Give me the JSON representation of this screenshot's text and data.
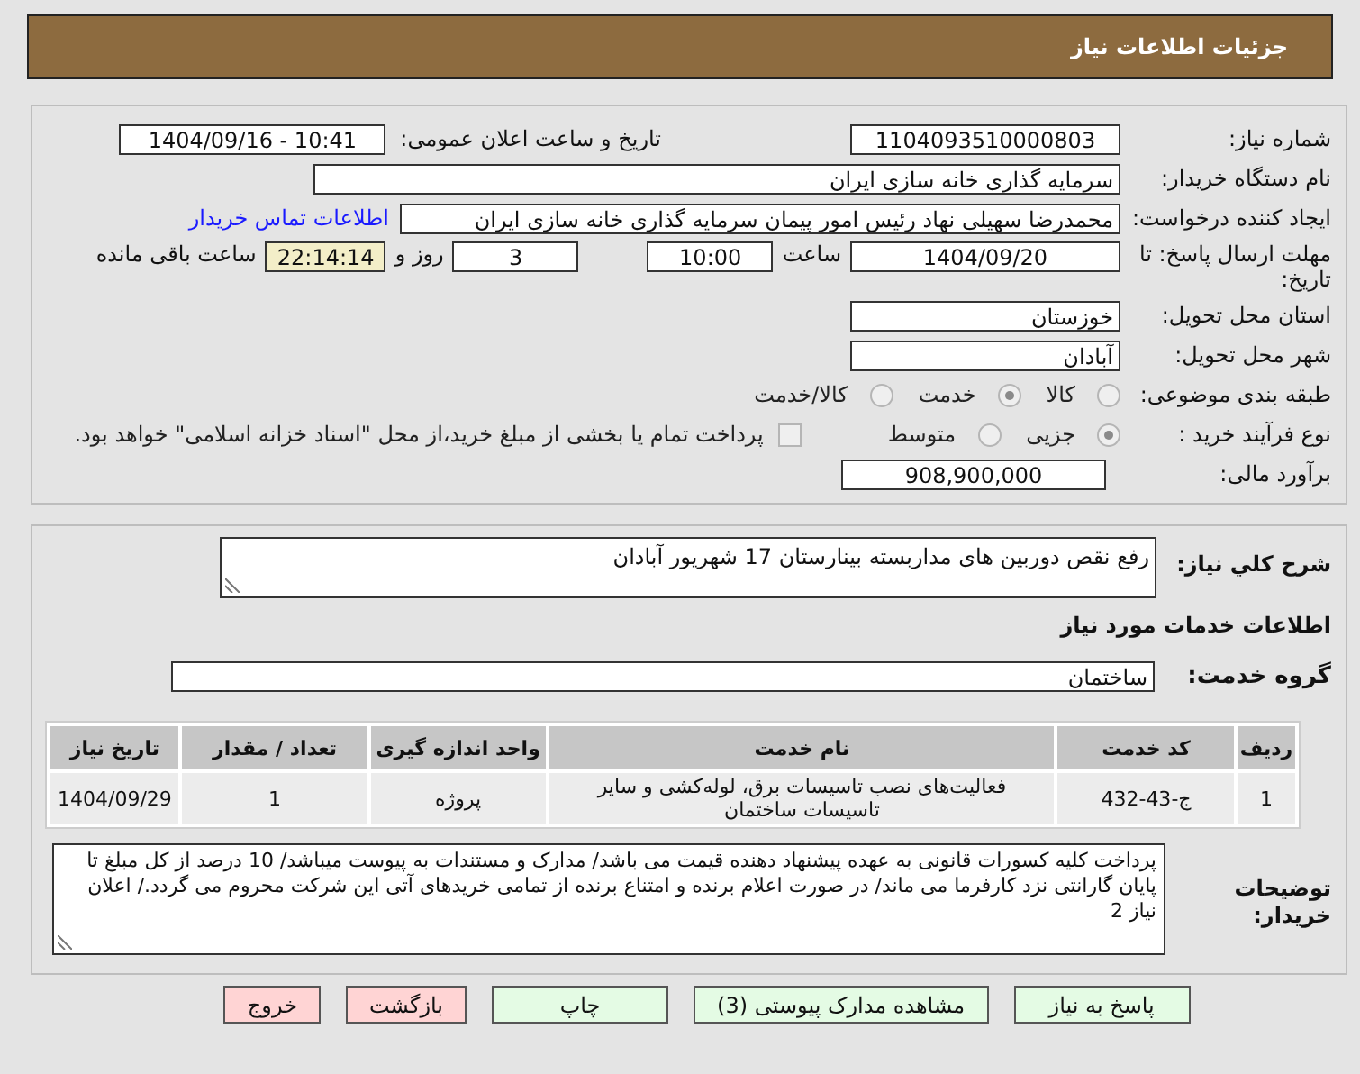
{
  "header": {
    "title": "جزئیات اطلاعات نیاز"
  },
  "need_number": {
    "label": "شماره نیاز:",
    "value": "1104093510000803"
  },
  "announce": {
    "label": "تاریخ و ساعت اعلان عمومی:",
    "value": "1404/09/16 - 10:41"
  },
  "buyer": {
    "label": "نام دستگاه خریدار:",
    "value": "سرمایه گذاری خانه سازی ایران"
  },
  "creator": {
    "label": "ایجاد کننده درخواست:",
    "value": "محمدرضا سهیلی نهاد رئیس امور پیمان سرمایه گذاری خانه سازی ایران",
    "link": "اطلاعات تماس خریدار"
  },
  "deadline": {
    "label": "مهلت ارسال پاسخ: تا تاریخ:",
    "date": "1404/09/20",
    "time_label": "ساعت",
    "time": "10:00",
    "days": "3",
    "days_label": "روز و",
    "remaining": "22:14:14",
    "remaining_label": "ساعت باقی مانده"
  },
  "province": {
    "label": "استان محل تحویل:",
    "value": "خوزستان"
  },
  "city": {
    "label": "شهر محل تحویل:",
    "value": "آبادان"
  },
  "category": {
    "label": "طبقه بندی موضوعی:",
    "options": [
      {
        "label": "کالا",
        "selected": false
      },
      {
        "label": "خدمت",
        "selected": true
      },
      {
        "label": "کالا/خدمت",
        "selected": false
      }
    ]
  },
  "process": {
    "label": "نوع فرآیند خرید :",
    "options": [
      {
        "label": "جزیی",
        "selected": true
      },
      {
        "label": "متوسط",
        "selected": false
      }
    ],
    "checkbox": {
      "label": "پرداخت تمام یا بخشی از مبلغ خرید،از محل \"اسناد خزانه اسلامی\" خواهد بود.",
      "checked": false
    }
  },
  "budget": {
    "label": "برآورد مالی:",
    "value": "908,900,000"
  },
  "description": {
    "label": "شرح کلي نياز:",
    "value": "رفع نقص دوربین های مداربسته بینارستان 17 شهریور آبادان"
  },
  "services_heading": "اطلاعات خدمات مورد نیاز",
  "service_group": {
    "label": "گروه خدمت:",
    "value": "ساختمان"
  },
  "table": {
    "columns": [
      "ردیف",
      "کد خدمت",
      "نام خدمت",
      "واحد اندازه گیری",
      "تعداد / مقدار",
      "تاریخ نیاز"
    ],
    "rows": [
      [
        "1",
        "ج-43-432",
        "فعالیت‌های نصب تاسیسات برق، لوله‌کشی و سایر تاسیسات ساختمان",
        "پروژه",
        "1",
        "1404/09/29"
      ]
    ]
  },
  "buyer_notes": {
    "label": "توضیحات خریدار:",
    "value": "پرداخت کلیه کسورات قانونی به عهده پیشنهاد دهنده قیمت می باشد/ مدارک و مستندات به پیوست میباشد/ 10 درصد از کل مبلغ تا پایان گارانتی نزد کارفرما می ماند/ در صورت اعلام برنده و امتناع برنده از تمامی خریدهای آتی این شرکت محروم می گردد./ اعلان نیاز 2"
  },
  "buttons": [
    {
      "label": "پاسخ به نیاز",
      "kind": "primary"
    },
    {
      "label": "مشاهده مدارک پیوستی (3)",
      "kind": "primary"
    },
    {
      "label": "چاپ",
      "kind": "primary"
    },
    {
      "label": "بازگشت",
      "kind": "danger"
    },
    {
      "label": "خروج",
      "kind": "danger"
    }
  ]
}
